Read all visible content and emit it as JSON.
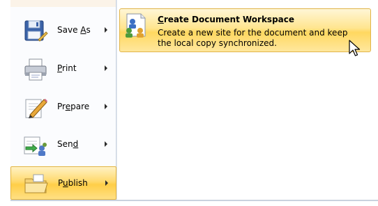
{
  "menu": {
    "items": [
      {
        "label_pre": "Save ",
        "label_key": "A",
        "label_post": "s",
        "icon": "save-as-icon"
      },
      {
        "label_pre": "",
        "label_key": "P",
        "label_post": "rint",
        "icon": "printer-icon"
      },
      {
        "label_pre": "Pr",
        "label_key": "e",
        "label_post": "pare",
        "icon": "prepare-pencil-icon"
      },
      {
        "label_pre": "Sen",
        "label_key": "d",
        "label_post": "",
        "icon": "send-icon"
      },
      {
        "label_pre": "P",
        "label_key": "u",
        "label_post": "blish",
        "icon": "publish-folder-icon"
      }
    ],
    "selected": "Publish"
  },
  "submenu": {
    "title_key": "C",
    "title_rest": "reate Document Workspace",
    "description": "Create a new site for the document and keep the local copy synchronized.",
    "icon": "document-workspace-icon"
  },
  "colors": {
    "highlight_top": "#fff2c4",
    "highlight_mid": "#ffd96d",
    "highlight_border": "#e2b33f",
    "column_bg": "#fbfcfe"
  }
}
